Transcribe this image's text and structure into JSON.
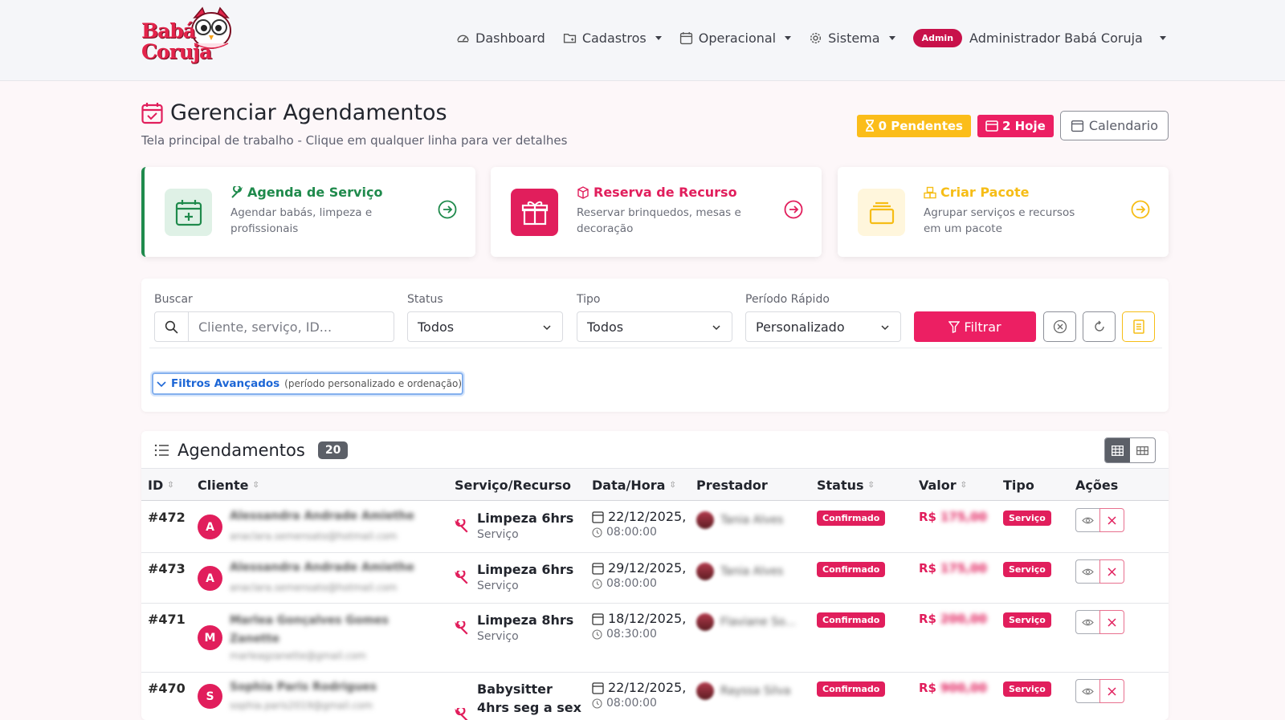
{
  "nav": {
    "logo_line1": "Babá",
    "logo_line2": "Coruja",
    "items": [
      {
        "label": "Dashboard",
        "icon": "dashboard-icon"
      },
      {
        "label": "Cadastros",
        "icon": "folder-icon"
      },
      {
        "label": "Operacional",
        "icon": "calendar-icon"
      },
      {
        "label": "Sistema",
        "icon": "gear-icon"
      }
    ],
    "admin_badge": "Admin",
    "user_name": "Administrador Babá Coruja"
  },
  "header": {
    "title": "Gerenciar Agendamentos",
    "subtitle": "Tela principal de trabalho - Clique em qualquer linha para ver detalhes",
    "pendentes": "0 Pendentes",
    "hoje": "2 Hoje",
    "calendario": "Calendario"
  },
  "quick_cards": [
    {
      "title": "Agenda de Serviço",
      "desc": "Agendar babás, limpeza e profissionais",
      "color": "#1f8a4c"
    },
    {
      "title": "Reserva de Recurso",
      "desc": "Reservar brinquedos, mesas e decoração",
      "color": "#e11e5c"
    },
    {
      "title": "Criar Pacote",
      "desc": "Agrupar serviços e recursos em um pacote",
      "color": "#f6bd16"
    }
  ],
  "filters": {
    "search_label": "Buscar",
    "search_placeholder": "Cliente, serviço, ID...",
    "status_label": "Status",
    "status_value": "Todos",
    "tipo_label": "Tipo",
    "tipo_value": "Todos",
    "periodo_label": "Período Rápido",
    "periodo_value": "Personalizado",
    "filtrar": "Filtrar",
    "advanced": "Filtros Avançados",
    "advanced_hint": "(período personalizado e ordenação)"
  },
  "table": {
    "title": "Agendamentos",
    "count": "20",
    "columns": {
      "id": "ID",
      "cliente": "Cliente",
      "servico": "Serviço/Recurso",
      "datahora": "Data/Hora",
      "prestador": "Prestador",
      "status": "Status",
      "valor": "Valor",
      "tipo": "Tipo",
      "acoes": "Ações"
    },
    "rows": [
      {
        "id": "#472",
        "initial": "A",
        "client_name": "Alessandra Andrade Amiethe",
        "client_email": "anaclara.semensato@hotmail.com",
        "service": "Limpeza 6hrs",
        "service_type": "Serviço",
        "date": "22/12/2025,",
        "time": "08:00:00",
        "provider": "Tania Alves",
        "status": "Confirmado",
        "currency": "R$",
        "value": "175,00",
        "tipo": "Serviço"
      },
      {
        "id": "#473",
        "initial": "A",
        "client_name": "Alessandra Andrade Amiethe",
        "client_email": "anaclara.semensato@hotmail.com",
        "service": "Limpeza 6hrs",
        "service_type": "Serviço",
        "date": "29/12/2025,",
        "time": "08:00:00",
        "provider": "Tania Alves",
        "status": "Confirmado",
        "currency": "R$",
        "value": "175,00",
        "tipo": "Serviço"
      },
      {
        "id": "#471",
        "initial": "M",
        "client_name": "Marlea Gonçalves Gomes Zanette",
        "client_email": "marleagzanette@gmail.com",
        "service": "Limpeza 8hrs",
        "service_type": "Serviço",
        "date": "18/12/2025,",
        "time": "08:30:00",
        "provider": "Flaviane So...",
        "status": "Confirmado",
        "currency": "R$",
        "value": "200,00",
        "tipo": "Serviço"
      },
      {
        "id": "#470",
        "initial": "S",
        "client_name": "Sophia Paris Rodrigues",
        "client_email": "sophia.paris2019@gmail.com",
        "service": "Babysitter 4hrs seg a sex",
        "service_type": "",
        "date": "22/12/2025,",
        "time": "08:00:00",
        "provider": "Rayssa Silva",
        "status": "Confirmado",
        "currency": "R$",
        "value": "900,00",
        "tipo": "Serviço"
      }
    ]
  }
}
